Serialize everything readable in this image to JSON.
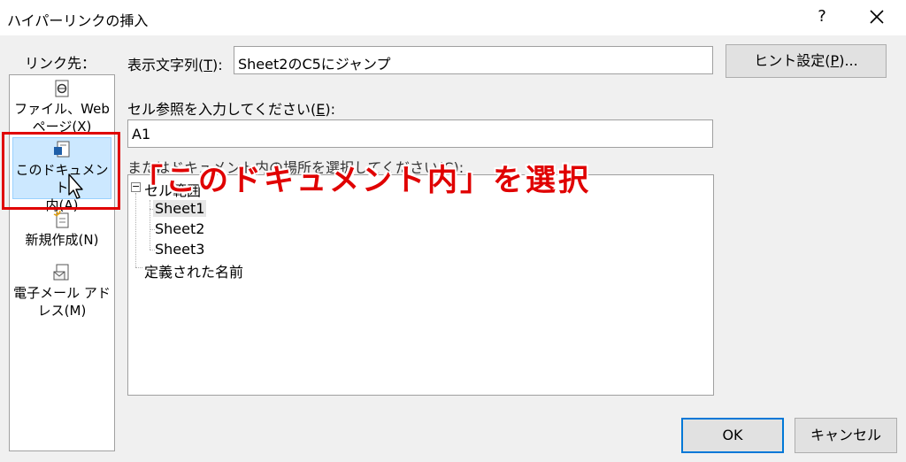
{
  "window": {
    "title": "ハイパーリンクの挿入",
    "help": "?"
  },
  "sidebar": {
    "heading": "リンク先：",
    "items": [
      {
        "label": "ファイル、Web\nページ(X)",
        "icon": "file-web-icon",
        "selected": false
      },
      {
        "label": "このドキュメント\n内(A)",
        "icon": "document-icon",
        "selected": true
      },
      {
        "label": "新規作成(N)",
        "icon": "new-document-icon",
        "selected": false
      },
      {
        "label": "電子メール アド\nレス(M)",
        "icon": "email-icon",
        "selected": false
      }
    ]
  },
  "display_text": {
    "label_pre": "表示文字列(",
    "label_key": "T",
    "label_post": "):",
    "value": "Sheet2のC5にジャンプ"
  },
  "tooltip_button": {
    "label_pre": "ヒント設定(",
    "label_key": "P",
    "label_post": ")..."
  },
  "cell_ref": {
    "label_pre": "セル参照を入力してください(",
    "label_key": "E",
    "label_post": "):",
    "value": "A1"
  },
  "place": {
    "label": "またはドキュメント内の場所を選択してください(C):"
  },
  "tree": {
    "root": "セル範囲",
    "sheets": [
      "Sheet1",
      "Sheet2",
      "Sheet3"
    ],
    "defined_names": "定義された名前"
  },
  "buttons": {
    "ok": "OK",
    "cancel": "キャンセル"
  },
  "annotation": {
    "text": "「このドキュメント内」を選択"
  },
  "colors": {
    "highlight": "#e00000",
    "selected_bg": "#cce8ff"
  }
}
